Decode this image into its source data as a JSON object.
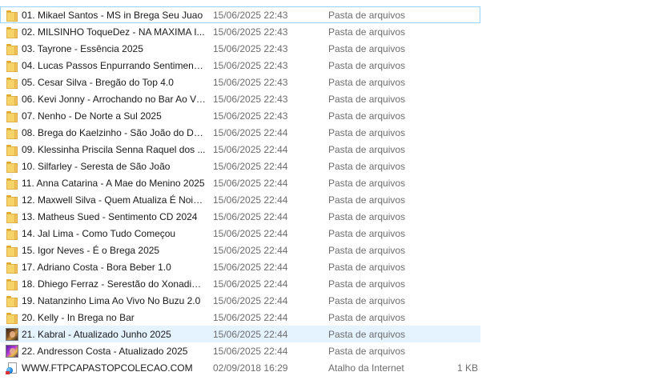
{
  "files": [
    {
      "name": "01. Mikael Santos - MS in Brega Seu Juao",
      "date": "15/06/2025 22:43",
      "type": "Pasta de arquivos",
      "size": "",
      "icon": "folder-icon",
      "state": "focused"
    },
    {
      "name": "02. MILSINHO ToqueDez - NA MAXIMA I...",
      "date": "15/06/2025 22:43",
      "type": "Pasta de arquivos",
      "size": "",
      "icon": "folder-icon",
      "state": ""
    },
    {
      "name": "03. Tayrone - Essência 2025",
      "date": "15/06/2025 22:43",
      "type": "Pasta de arquivos",
      "size": "",
      "icon": "folder-icon",
      "state": ""
    },
    {
      "name": "04. Lucas Passos Enpurrando Sentimento...",
      "date": "15/06/2025 22:43",
      "type": "Pasta de arquivos",
      "size": "",
      "icon": "folder-icon",
      "state": ""
    },
    {
      "name": "05. Cesar Silva - Bregão do Top 4.0",
      "date": "15/06/2025 22:43",
      "type": "Pasta de arquivos",
      "size": "",
      "icon": "folder-icon",
      "state": ""
    },
    {
      "name": "06. Kevi Jonny - Arrochando no Bar Ao Vi...",
      "date": "15/06/2025 22:43",
      "type": "Pasta de arquivos",
      "size": "",
      "icon": "folder-icon",
      "state": ""
    },
    {
      "name": "07. Nenho - De Norte a Sul 2025",
      "date": "15/06/2025 22:43",
      "type": "Pasta de arquivos",
      "size": "",
      "icon": "folder-icon",
      "state": ""
    },
    {
      "name": "08. Brega do Kaelzinho - São João do Des...",
      "date": "15/06/2025 22:44",
      "type": "Pasta de arquivos",
      "size": "",
      "icon": "folder-icon",
      "state": ""
    },
    {
      "name": "09. Klessinha  Priscila Senna  Raquel dos ...",
      "date": "15/06/2025 22:44",
      "type": "Pasta de arquivos",
      "size": "",
      "icon": "folder-icon",
      "state": ""
    },
    {
      "name": "10. Silfarley - Seresta de São João",
      "date": "15/06/2025 22:44",
      "type": "Pasta de arquivos",
      "size": "",
      "icon": "folder-icon",
      "state": ""
    },
    {
      "name": "11. Anna Catarina - A Mae do Menino 2025",
      "date": "15/06/2025 22:44",
      "type": "Pasta de arquivos",
      "size": "",
      "icon": "folder-icon",
      "state": ""
    },
    {
      "name": "12. Maxwell Silva - Quem Atualiza É Nois ...",
      "date": "15/06/2025 22:44",
      "type": "Pasta de arquivos",
      "size": "",
      "icon": "folder-icon",
      "state": ""
    },
    {
      "name": "13. Matheus Sued - Sentimento CD 2024",
      "date": "15/06/2025 22:44",
      "type": "Pasta de arquivos",
      "size": "",
      "icon": "folder-icon",
      "state": ""
    },
    {
      "name": "14. Jal Lima - Como Tudo Começou",
      "date": "15/06/2025 22:44",
      "type": "Pasta de arquivos",
      "size": "",
      "icon": "folder-icon",
      "state": ""
    },
    {
      "name": "15. Igor Neves - É o Brega 2025",
      "date": "15/06/2025 22:44",
      "type": "Pasta de arquivos",
      "size": "",
      "icon": "folder-icon",
      "state": ""
    },
    {
      "name": "17. Adriano Costa - Bora Beber 1.0",
      "date": "15/06/2025 22:44",
      "type": "Pasta de arquivos",
      "size": "",
      "icon": "folder-icon",
      "state": ""
    },
    {
      "name": "18. Dhiego Ferraz - Serestão do Xonadinh...",
      "date": "15/06/2025 22:44",
      "type": "Pasta de arquivos",
      "size": "",
      "icon": "folder-icon",
      "state": ""
    },
    {
      "name": "19. Natanzinho Lima Ao Vivo No Buzu 2.0",
      "date": "15/06/2025 22:44",
      "type": "Pasta de arquivos",
      "size": "",
      "icon": "folder-icon",
      "state": ""
    },
    {
      "name": "20. Kelly - In Brega no Bar",
      "date": "15/06/2025 22:44",
      "type": "Pasta de arquivos",
      "size": "",
      "icon": "folder-icon",
      "state": ""
    },
    {
      "name": "21. Kabral - Atualizado Junho 2025",
      "date": "15/06/2025 22:44",
      "type": "Pasta de arquivos",
      "size": "",
      "icon": "album-thumbnail-icon",
      "state": "hovered"
    },
    {
      "name": "22. Andresson Costa - Atualizado 2025",
      "date": "15/06/2025 22:44",
      "type": "Pasta de arquivos",
      "size": "",
      "icon": "album-thumbnail-icon",
      "state": ""
    },
    {
      "name": "WWW.FTPCAPASTOPCOLECAO.COM",
      "date": "02/09/2018 16:29",
      "type": "Atalho da Internet",
      "size": "1 KB",
      "icon": "internet-shortcut-icon",
      "state": ""
    }
  ],
  "colors": {
    "focus_border": "#99d1ff",
    "hover_background": "#e5f3ff",
    "folder_yellow": "#f7d469",
    "meta_text": "#6d6d6d"
  }
}
